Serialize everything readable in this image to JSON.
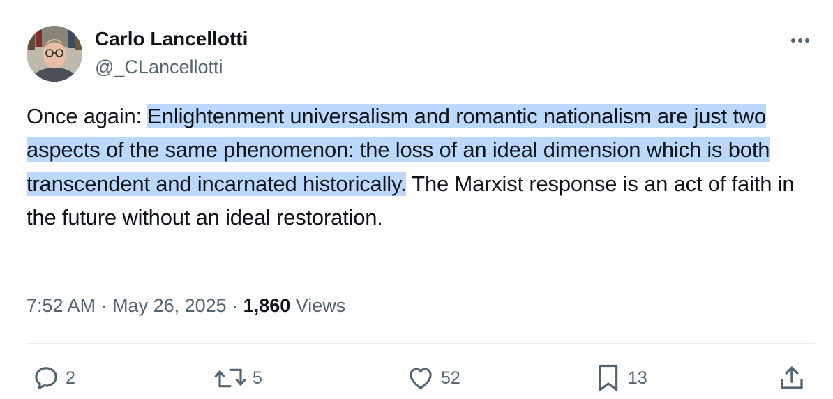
{
  "author": {
    "name": "Carlo Lancellotti",
    "handle": "@_CLancellotti"
  },
  "tweet": {
    "prefix": "Once again: ",
    "highlighted": "Enlightenment universalism and romantic nationalism are just two aspects of the same phenomenon: the loss of an ideal dimension which is both transcendent and incarnated historically.",
    "suffix": " The Marxist response is an act of faith in the future without an ideal restoration."
  },
  "meta": {
    "time": "7:52 AM",
    "separator": " · ",
    "date": "May 26, 2025",
    "views_count": "1,860",
    "views_label": " Views"
  },
  "actions": {
    "replies": "2",
    "reposts": "5",
    "likes": "52",
    "bookmarks": "13"
  },
  "icons": {
    "more": "more-dots-icon",
    "reply": "reply-bubble-icon",
    "repost": "repost-arrows-icon",
    "like": "heart-icon",
    "bookmark": "bookmark-icon",
    "share": "share-upload-icon"
  },
  "colors": {
    "text": "#0f1419",
    "secondary": "#536471",
    "highlight": "#bcd8fd",
    "divider": "#e6ecf0"
  }
}
